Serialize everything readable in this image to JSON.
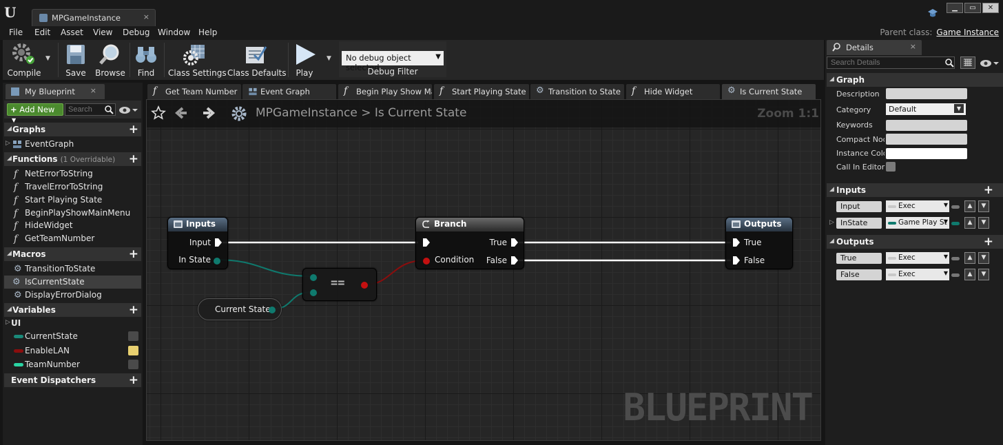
{
  "window": {
    "tab_title": "MPGameInstance",
    "close_glyph": "×",
    "controls": [
      "▁",
      "▭",
      "✕"
    ]
  },
  "menu": {
    "items": [
      "File",
      "Edit",
      "Asset",
      "View",
      "Debug",
      "Window",
      "Help"
    ],
    "parent_class_label": "Parent class:",
    "parent_class_value": "Game Instance"
  },
  "toolbar": {
    "compile": "Compile",
    "save": "Save",
    "browse": "Browse",
    "find": "Find",
    "class_settings": "Class Settings",
    "class_defaults": "Class Defaults",
    "play": "Play",
    "debug_select": "No debug object selected",
    "debug_filter": "Debug Filter"
  },
  "left_panel": {
    "tab_label": "My Blueprint",
    "add_new": "Add New",
    "search_placeholder": "Search",
    "graphs": {
      "title": "Graphs",
      "items": [
        "EventGraph"
      ]
    },
    "functions": {
      "title": "Functions",
      "subtitle": "(1 Overridable)",
      "items": [
        "NetErrorToString",
        "TravelErrorToString",
        "Start Playing State",
        "BeginPlayShowMainMenu",
        "HideWidget",
        "GetTeamNumber"
      ]
    },
    "macros": {
      "title": "Macros",
      "items": [
        "TransitionToState",
        "IsCurrentState",
        "DisplayErrorDialog"
      ]
    },
    "variables": {
      "title": "Variables",
      "category": "UI",
      "items": [
        {
          "name": "CurrentState",
          "color": "#1a8a7a"
        },
        {
          "name": "EnableLAN",
          "color": "#8a0e0e"
        },
        {
          "name": "TeamNumber",
          "color": "#2ad3a2"
        }
      ]
    },
    "event_dispatchers": {
      "title": "Event Dispatchers"
    }
  },
  "graph_tabs": [
    {
      "label": "Get Team Number",
      "icon": "function-icon"
    },
    {
      "label": "Event Graph",
      "icon": "event-graph-icon"
    },
    {
      "label": "Begin Play Show Main Menu",
      "icon": "function-icon"
    },
    {
      "label": "Start Playing State",
      "icon": "function-icon"
    },
    {
      "label": "Transition to State",
      "icon": "macro-icon"
    },
    {
      "label": "Hide Widget",
      "icon": "function-icon"
    },
    {
      "label": "Is Current State",
      "icon": "macro-icon"
    }
  ],
  "graph": {
    "breadcrumb_root": "MPGameInstance",
    "breadcrumb_sep": ">",
    "breadcrumb_leaf": "Is Current State",
    "zoom": "Zoom 1:1",
    "watermark": "BLUEPRINT",
    "nodes": {
      "inputs": {
        "title": "Inputs",
        "pins": [
          "Input",
          "In State"
        ]
      },
      "equal": {
        "label": "=="
      },
      "current_state": {
        "label": "Current State"
      },
      "branch": {
        "title": "Branch",
        "pins": [
          "Condition",
          "True",
          "False"
        ]
      },
      "outputs": {
        "title": "Outputs",
        "pins": [
          "True",
          "False"
        ]
      }
    },
    "colors": {
      "exec": "#ffffff",
      "enum": "#0f7a6e",
      "bool": "#8c0d0d"
    }
  },
  "details": {
    "tab_label": "Details",
    "search_placeholder": "Search Details",
    "graph_section": {
      "title": "Graph",
      "rows": [
        "Description",
        "Category",
        "Keywords",
        "Compact Node",
        "Instance Color",
        "Call In Editor"
      ],
      "category_value": "Default"
    },
    "inputs_section": {
      "title": "Inputs",
      "pins": [
        {
          "name": "Input",
          "type": "Exec",
          "color": "#c8c8c8"
        },
        {
          "name": "InState",
          "type": "Game Play St",
          "color": "#0f7a6e"
        }
      ]
    },
    "outputs_section": {
      "title": "Outputs",
      "pins": [
        {
          "name": "True",
          "type": "Exec",
          "color": "#c8c8c8"
        },
        {
          "name": "False",
          "type": "Exec",
          "color": "#c8c8c8"
        }
      ]
    }
  }
}
